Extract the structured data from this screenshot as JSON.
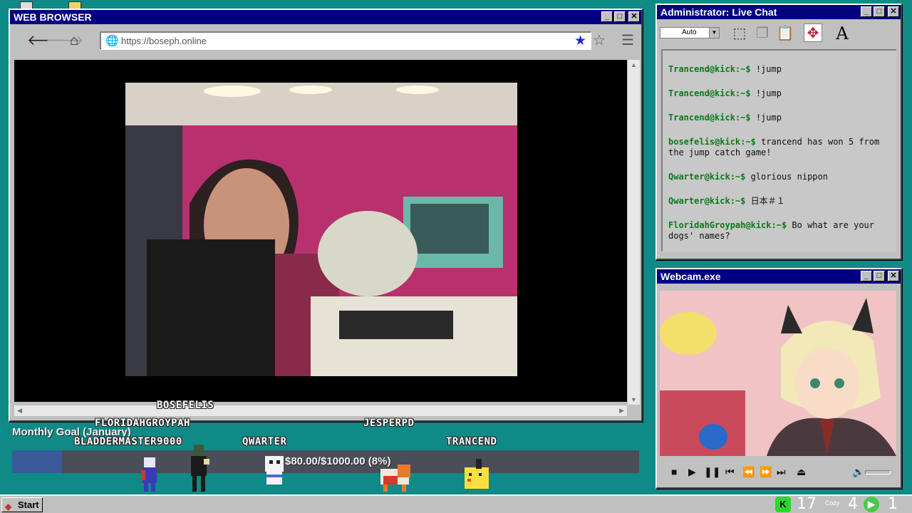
{
  "browser": {
    "title": "WEB BROWSER",
    "url": "https://boseph.online",
    "controls": {
      "minimize": "_",
      "maximize": "□",
      "close": "✕"
    }
  },
  "chat": {
    "title": "Administrator: Live Chat",
    "font_size": "Auto",
    "messages": [
      {
        "user": "Trancend@kick:~$",
        "text": "!jump"
      },
      {
        "user": "Trancend@kick:~$",
        "text": "!jump"
      },
      {
        "user": "Trancend@kick:~$",
        "text": "!jump"
      },
      {
        "user": "bosefelis@kick:~$",
        "text": "trancend has won 5 from the jump catch game!"
      },
      {
        "user": "Qwarter@kick:~$",
        "text": "glorious nippon"
      },
      {
        "user": "Qwarter@kick:~$",
        "text": "日本＃１"
      },
      {
        "user": "FloridahGroypah@kick:~$",
        "text": "Bo what are your dogs' names?"
      }
    ]
  },
  "webcam": {
    "title": "Webcam.exe"
  },
  "goal": {
    "label": "Monthly Goal (January)",
    "progress_text": "$80.00/$1000.00 (8%)",
    "fraction": 0.08
  },
  "viewers": [
    {
      "name": "BOSEFELIS"
    },
    {
      "name": "FLORIDAHGROYPAH"
    },
    {
      "name": "BLADDERMASTER9000"
    },
    {
      "name": "QWARTER"
    },
    {
      "name": "JESPERPD"
    },
    {
      "name": "TRANCEND"
    }
  ],
  "taskbar": {
    "start_label": "Start",
    "stat_1": "17",
    "stat_2": "4",
    "stat_3": "1",
    "stat_label": "Cozy"
  }
}
